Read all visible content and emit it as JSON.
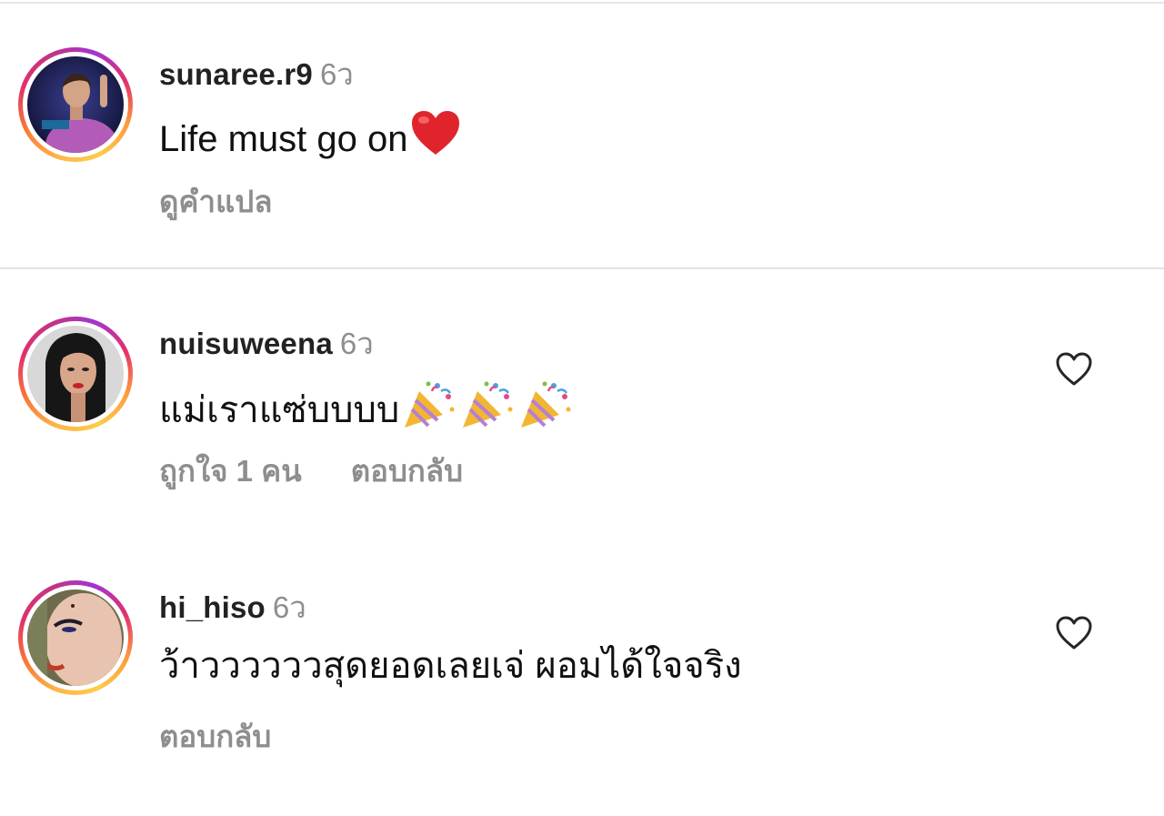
{
  "comments": [
    {
      "username": "sunaree.r9",
      "time": "6ว",
      "text": "Life must go on",
      "emoji": "heart-emoji",
      "action_primary": "ดูคำแปล",
      "has_like_icon": false
    },
    {
      "username": "nuisuweena",
      "time": "6ว",
      "text": "แม่เราแซ่บบบบ",
      "emoji": "party-popper-emoji",
      "emoji_count": 3,
      "action_primary": "ถูกใจ 1 คน",
      "action_secondary": "ตอบกลับ",
      "has_like_icon": true
    },
    {
      "username": "hi_hiso",
      "time": "6ว",
      "text": "ว้าววววววสุดยอดเลยเจ่ ผอมได้ใจจริง",
      "action_primary": "ตอบกลับ",
      "has_like_icon": true
    }
  ],
  "colors": {
    "secondary_text": "#8e8e8e",
    "divider": "#e3e3e3",
    "heart_emoji": "#e0242b",
    "story_ring": [
      "#fdb54a",
      "#e1306c",
      "#c13584"
    ]
  }
}
